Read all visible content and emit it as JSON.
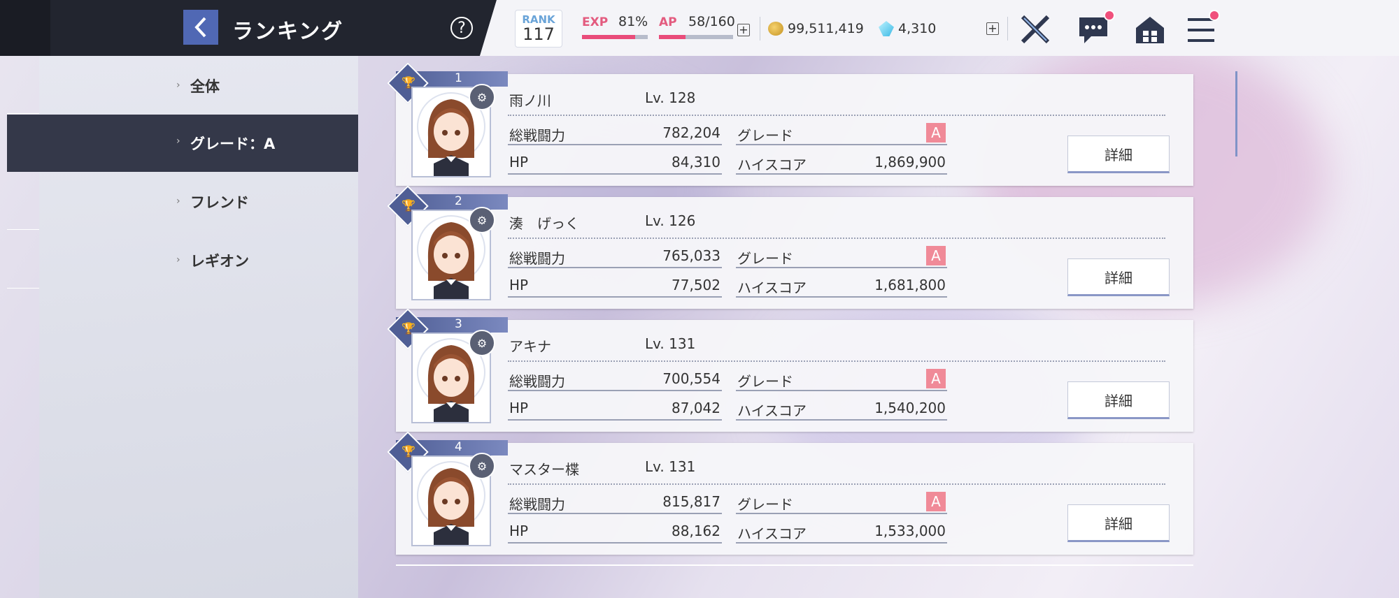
{
  "header": {
    "title": "ランキング",
    "back_icon": "chevron-left-icon",
    "help": "?",
    "rank_label": "RANK",
    "rank_value": "117",
    "exp_label": "EXP",
    "exp_value": "81%",
    "exp_progress": 0.81,
    "ap_label": "AP",
    "ap_value": "58/160",
    "ap_progress": 0.36,
    "coins": "99,511,419",
    "gems": "4,310",
    "plus": "+"
  },
  "sidebar": {
    "items": [
      {
        "label": "全体",
        "active": false
      },
      {
        "label": "グレード：A",
        "active": true
      },
      {
        "label": "フレンド",
        "active": false
      },
      {
        "label": "レギオン",
        "active": false
      }
    ]
  },
  "labels": {
    "power": "総戦闘力",
    "grade": "グレード",
    "hp": "HP",
    "highscore": "ハイスコア",
    "detail": "詳細",
    "grade_value": "A"
  },
  "ranking": [
    {
      "rank": "1",
      "name": "雨ノ川",
      "level": "Lv. 128",
      "power": "782,204",
      "hp": "84,310",
      "highscore": "1,869,900"
    },
    {
      "rank": "2",
      "name": "湊　げっく",
      "level": "Lv. 126",
      "power": "765,033",
      "hp": "77,502",
      "highscore": "1,681,800"
    },
    {
      "rank": "3",
      "name": "アキナ",
      "level": "Lv. 131",
      "power": "700,554",
      "hp": "87,042",
      "highscore": "1,540,200"
    },
    {
      "rank": "4",
      "name": "マスター楪",
      "level": "Lv. 131",
      "power": "815,817",
      "hp": "88,162",
      "highscore": "1,533,000"
    }
  ],
  "colors": {
    "accent_pink": "#e94c7a",
    "header_dark": "#22252f",
    "active_tab": "#343849",
    "grade_badge": "#f08a98"
  }
}
